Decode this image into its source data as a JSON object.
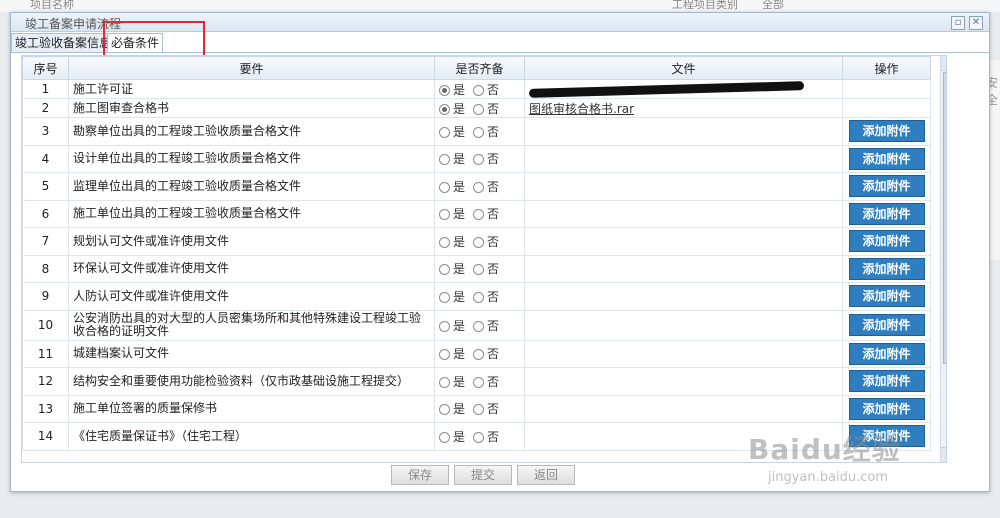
{
  "background": {
    "field_left": "项目名称",
    "field_right": "工程项目类别",
    "field_right_value": "全部",
    "side_text": "安全"
  },
  "dialog": {
    "title": "竣工备案申请流程",
    "restore_icon": "restore-icon",
    "close_icon": "close-icon"
  },
  "tabs": [
    {
      "label": "竣工验收备案信息"
    },
    {
      "label": "必备条件"
    }
  ],
  "table": {
    "headers": {
      "seq": "序号",
      "requirement": "要件",
      "complete": "是否齐备",
      "file": "文件",
      "action": "操作"
    },
    "option_yes": "是",
    "option_no": "否",
    "add_button": "添加附件",
    "rows": [
      {
        "seq": "1",
        "requirement": "施工许可证",
        "yes_checked": true,
        "file": "施工许可证",
        "file_redacted": true
      },
      {
        "seq": "2",
        "requirement": "施工图审查合格书",
        "yes_checked": true,
        "file": "图纸审核合格书.rar"
      },
      {
        "seq": "3",
        "requirement": "勘察单位出具的工程竣工验收质量合格文件",
        "yes_checked": false,
        "file": ""
      },
      {
        "seq": "4",
        "requirement": "设计单位出具的工程竣工验收质量合格文件",
        "yes_checked": false,
        "file": ""
      },
      {
        "seq": "5",
        "requirement": "监理单位出具的工程竣工验收质量合格文件",
        "yes_checked": false,
        "file": ""
      },
      {
        "seq": "6",
        "requirement": "施工单位出具的工程竣工验收质量合格文件",
        "yes_checked": false,
        "file": ""
      },
      {
        "seq": "7",
        "requirement": "规划认可文件或准许使用文件",
        "yes_checked": false,
        "file": ""
      },
      {
        "seq": "8",
        "requirement": "环保认可文件或准许使用文件",
        "yes_checked": false,
        "file": ""
      },
      {
        "seq": "9",
        "requirement": "人防认可文件或准许使用文件",
        "yes_checked": false,
        "file": ""
      },
      {
        "seq": "10",
        "requirement": "公安消防出具的对大型的人员密集场所和其他特殊建设工程竣工验收合格的证明文件",
        "yes_checked": false,
        "file": ""
      },
      {
        "seq": "11",
        "requirement": "城建档案认可文件",
        "yes_checked": false,
        "file": ""
      },
      {
        "seq": "12",
        "requirement": "结构安全和重要使用功能检验资料（仅市政基础设施工程提交）",
        "yes_checked": false,
        "file": ""
      },
      {
        "seq": "13",
        "requirement": "施工单位签署的质量保修书",
        "yes_checked": false,
        "file": ""
      },
      {
        "seq": "14",
        "requirement": "《住宅质量保证书》（住宅工程）",
        "yes_checked": false,
        "file": ""
      }
    ]
  },
  "footer": {
    "save": "保存",
    "submit": "提交",
    "back": "返回"
  },
  "watermark": {
    "text": "Baidu经验",
    "sub": "jingyan.baidu.com"
  }
}
